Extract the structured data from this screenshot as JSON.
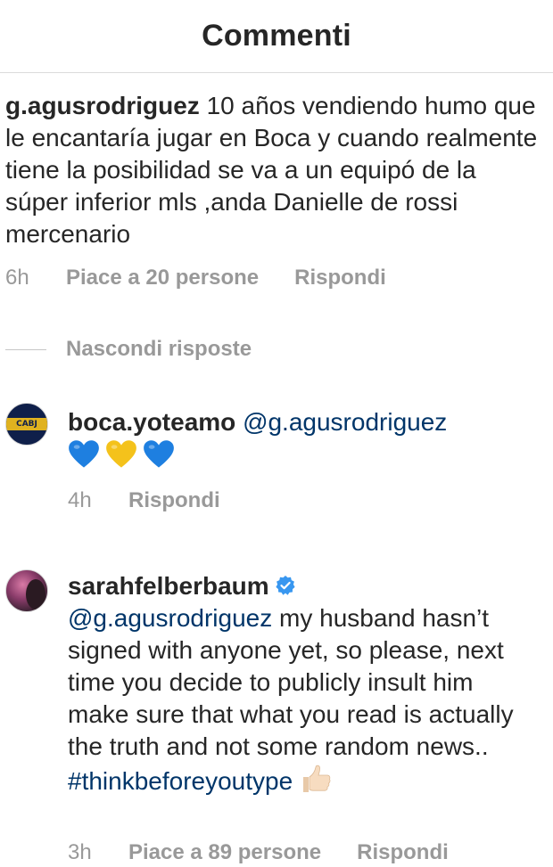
{
  "header": {
    "title": "Commenti"
  },
  "main_comment": {
    "username": "g.agusrodriguez",
    "text": "10 años vendiendo humo que le encantaría jugar en Boca y cuando realmente tiene la posibilidad se va a un equipó de la súper inferior mls ,anda Danielle de rossi mercenario",
    "time": "6h",
    "likes": "Piace a 20 persone",
    "reply_label": "Rispondi"
  },
  "hide_replies_label": "Nascondi risposte",
  "replies": [
    {
      "username": "boca.yoteamo",
      "avatar_text": "CABJ",
      "mention": "@g.agusrodriguez",
      "emojis": [
        "blue-heart",
        "yellow-heart",
        "blue-heart"
      ],
      "time": "4h",
      "reply_label": "Rispondi"
    },
    {
      "username": "sarahfelberbaum",
      "verified": true,
      "mention": "@g.agusrodriguez",
      "text": "my husband hasn’t signed with anyone yet, so please, next time you decide to publicly insult him make sure that what you read is actually the truth and not some random news..",
      "hashtag": "#thinkbeforeyoutype",
      "emoji": "thumbs-up",
      "time": "3h",
      "likes": "Piace a 89 persone",
      "reply_label": "Rispondi"
    }
  ],
  "colors": {
    "text": "#262626",
    "secondary": "#999999",
    "link": "#003569",
    "verified": "#3897f0",
    "divider": "#dbdbdb",
    "blue_heart": "#1e7fe0",
    "yellow_heart": "#f4c21b"
  }
}
